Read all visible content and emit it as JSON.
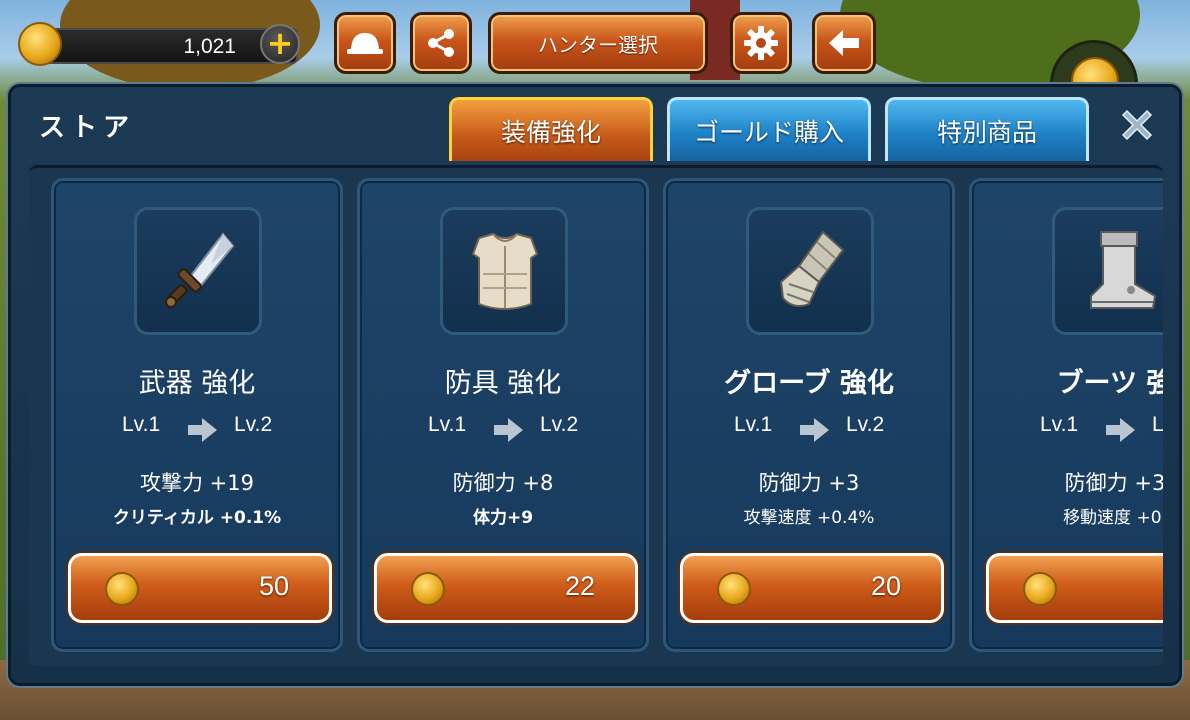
{
  "hud": {
    "gold_amount": "1,021",
    "hunter_select_label": "ハンター選択",
    "icons": [
      "hat-icon",
      "share-icon",
      "gear-icon",
      "back-arrow-icon",
      "plus-icon",
      "gold-coin-icon"
    ]
  },
  "store": {
    "title": "ストア",
    "tabs": [
      {
        "label": "装備強化",
        "active": true
      },
      {
        "label": "ゴールド購入",
        "active": false
      },
      {
        "label": "特別商品",
        "active": false
      }
    ],
    "close_icon": "close-x-icon",
    "items": [
      {
        "name": "武器 強化",
        "icon": "sword-icon",
        "lv_from": "Lv.1",
        "lv_to": "Lv.2",
        "stat1": "攻撃力 +19",
        "stat2": "クリティカル +0.1%",
        "price": "50"
      },
      {
        "name": "防具 強化",
        "icon": "armor-icon",
        "lv_from": "Lv.1",
        "lv_to": "Lv.2",
        "stat1": "防御力 +8",
        "stat2": "体力+9",
        "price": "22"
      },
      {
        "name": "グローブ 強化",
        "icon": "glove-icon",
        "lv_from": "Lv.1",
        "lv_to": "Lv.2",
        "stat1": "防御力 +3",
        "stat2": "攻撃速度 +0.4%",
        "price": "20"
      },
      {
        "name": "ブーツ 強",
        "icon": "boots-icon",
        "lv_from": "Lv.1",
        "lv_to": "L",
        "stat1": "防御力 +3",
        "stat2": "移動速度 +0.",
        "price": ""
      }
    ]
  },
  "colors": {
    "button_orange": "#c9561a",
    "tab_active_border": "#ffd23a",
    "tab_blue": "#1f82c6",
    "panel_blue": "#1d3a55",
    "gold": "#e8a81c"
  }
}
